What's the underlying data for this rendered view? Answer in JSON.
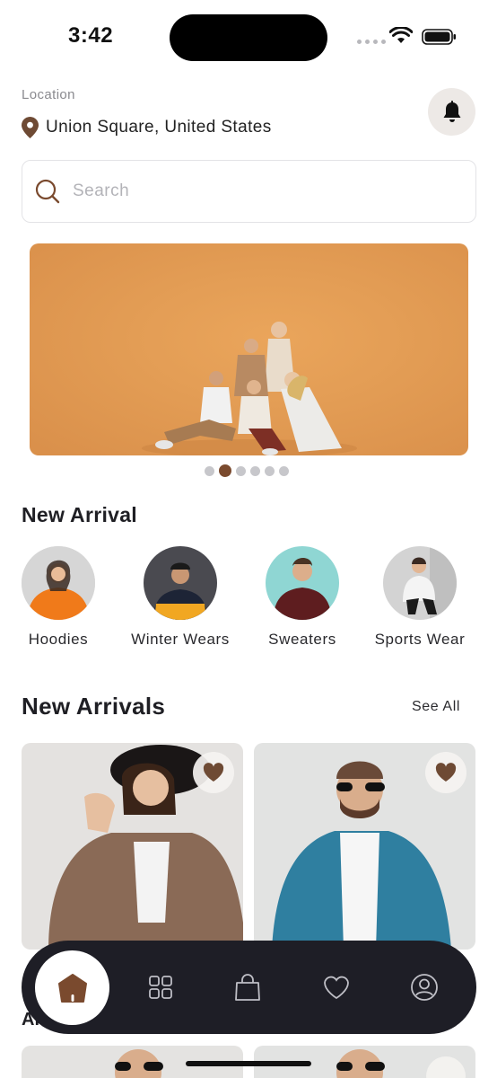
{
  "status_bar": {
    "time": "3:42"
  },
  "header": {
    "location_label": "Location",
    "location": "Union Square, United States",
    "icons": {
      "pin": "location-pin-icon",
      "bell": "bell-icon"
    }
  },
  "search": {
    "placeholder": "Search",
    "value": "",
    "icon": "search-icon"
  },
  "banner": {
    "slides": 6,
    "active_slide": 2
  },
  "categories": {
    "title": "New Arrival",
    "items": [
      {
        "label": "Hoodies"
      },
      {
        "label": "Winter Wears"
      },
      {
        "label": "Sweaters"
      },
      {
        "label": "Sports Wear"
      }
    ]
  },
  "new_arrivals": {
    "title": "New Arrivals",
    "see_all": "See All"
  },
  "next_section": {
    "title_partial": "Al"
  },
  "bottom_nav": {
    "items": [
      "home-icon",
      "grid-icon",
      "bag-icon",
      "heart-icon",
      "profile-icon"
    ],
    "active": "home-icon"
  },
  "colors": {
    "accent_brown": "#7a4a2e",
    "nav_dark": "#1e1e26",
    "banner_orange": "#e39d55"
  }
}
